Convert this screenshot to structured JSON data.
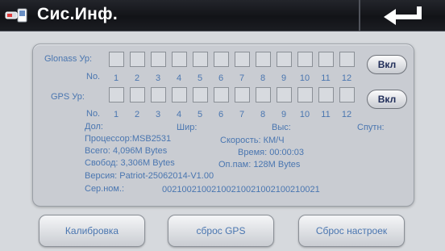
{
  "header": {
    "title": "Сис.Инф."
  },
  "icons": {
    "title": "battery-phone-icon",
    "back": "return-arrow-icon"
  },
  "glonass": {
    "label": "Glonass Ур:",
    "no_label": "No.",
    "numbers": [
      "1",
      "2",
      "3",
      "4",
      "5",
      "6",
      "7",
      "8",
      "9",
      "10",
      "11",
      "12"
    ],
    "button": "Вкл"
  },
  "gps": {
    "label": "GPS Ур:",
    "no_label": "No.",
    "numbers": [
      "1",
      "2",
      "3",
      "4",
      "5",
      "6",
      "7",
      "8",
      "9",
      "10",
      "11",
      "12"
    ],
    "button": "Вкл"
  },
  "status": {
    "lon": "Дол:",
    "lat": "Шир:",
    "alt": "Выс:",
    "sat": "Спутн:"
  },
  "info": {
    "processor": "Процессор:MSB2531",
    "speed": "Скорость:  КМ/Ч",
    "total": "Всего: 4,096M Bytes",
    "time": "Время: 00:00:03",
    "free": "Свобод: 3,306M Bytes",
    "ram": "Оп.пам: 128M Bytes",
    "version": "Версия: Patriot-25062014-V1.00",
    "serial_label": "Сер.ном.:",
    "serial": "00210021002100210021002100210021"
  },
  "buttons": {
    "calibrate": "Калибровка",
    "reset_gps": "сброс GPS",
    "reset_settings": "Сброс настроек"
  },
  "colors": {
    "text": "#4a76b0",
    "title_bar": "#121317",
    "panel": "#c9ccd2",
    "background": "#d6d9dd"
  }
}
